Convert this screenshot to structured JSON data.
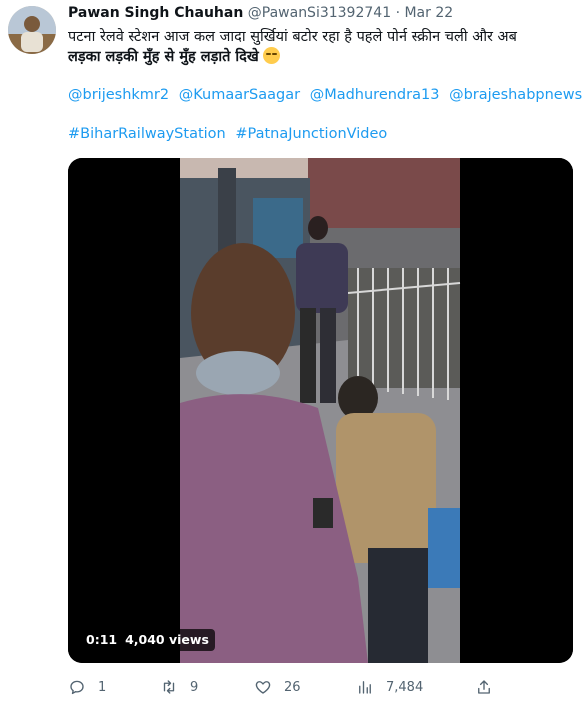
{
  "tweet": {
    "author_name": "Pawan Singh Chauhan",
    "handle": "@PawanSi31392741",
    "separator": "·",
    "date": "Mar 22",
    "text_line1": "पटना रेलवे स्टेशन आज कल जादा सुर्खियां बटोर रहा है पहले पोर्न स्क्रीन चली और अब",
    "text_line2": "लड़का लड़की मुँह से मुँह लड़ाते दिखे",
    "emoji": "smirking-face-emoji",
    "mentions": [
      "@brijeshkmr2",
      "@KumaarSaagar",
      "@Madhurendra13",
      "@brajeshabpnews"
    ],
    "hashtags": [
      "#BiharRailwayStation",
      "#PatnaJunctionVideo"
    ]
  },
  "video": {
    "duration": "0:11",
    "views": "4,040 views"
  },
  "actions": {
    "replies": "1",
    "retweets": "9",
    "likes": "26",
    "views": "7,484"
  },
  "colors": {
    "link": "#1d9bf0",
    "secondary_text": "#536471",
    "primary_text": "#0f1419"
  },
  "icons": {
    "reply": "reply-icon",
    "retweet": "retweet-icon",
    "like": "heart-icon",
    "views": "analytics-icon",
    "share": "share-icon"
  }
}
